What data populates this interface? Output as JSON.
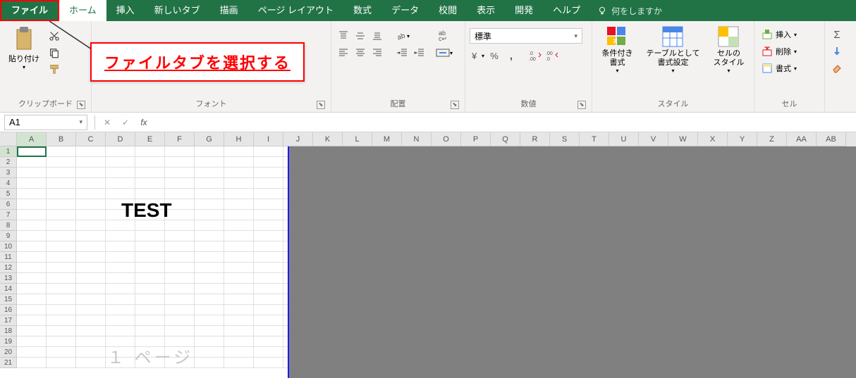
{
  "tabs": {
    "file": "ファイル",
    "home": "ホーム",
    "insert": "挿入",
    "newtab": "新しいタブ",
    "draw": "描画",
    "pagelayout": "ページ レイアウト",
    "formulas": "数式",
    "data": "データ",
    "review": "校閲",
    "view": "表示",
    "developer": "開発",
    "help": "ヘルプ",
    "tellme": "何をしますか"
  },
  "ribbon": {
    "clipboard": {
      "paste": "貼り付け",
      "label": "クリップボード"
    },
    "font": {
      "label": "フォント"
    },
    "alignment": {
      "label": "配置"
    },
    "number": {
      "format": "標準",
      "label": "数値"
    },
    "styles": {
      "cond": "条件付き\n書式",
      "table": "テーブルとして\n書式設定",
      "cell": "セルの\nスタイル",
      "label": "スタイル"
    },
    "cells": {
      "insert": "挿入",
      "delete": "削除",
      "format": "書式",
      "label": "セル"
    }
  },
  "callout": "ファイルタブを選択する",
  "namebox": "A1",
  "columns": [
    "A",
    "B",
    "C",
    "D",
    "E",
    "F",
    "G",
    "H",
    "I",
    "J",
    "K",
    "L",
    "M",
    "N",
    "O",
    "P",
    "Q",
    "R",
    "S",
    "T",
    "U",
    "V",
    "W",
    "X",
    "Y",
    "Z",
    "AA",
    "AB"
  ],
  "test": "TEST",
  "watermark": "１ ページ"
}
